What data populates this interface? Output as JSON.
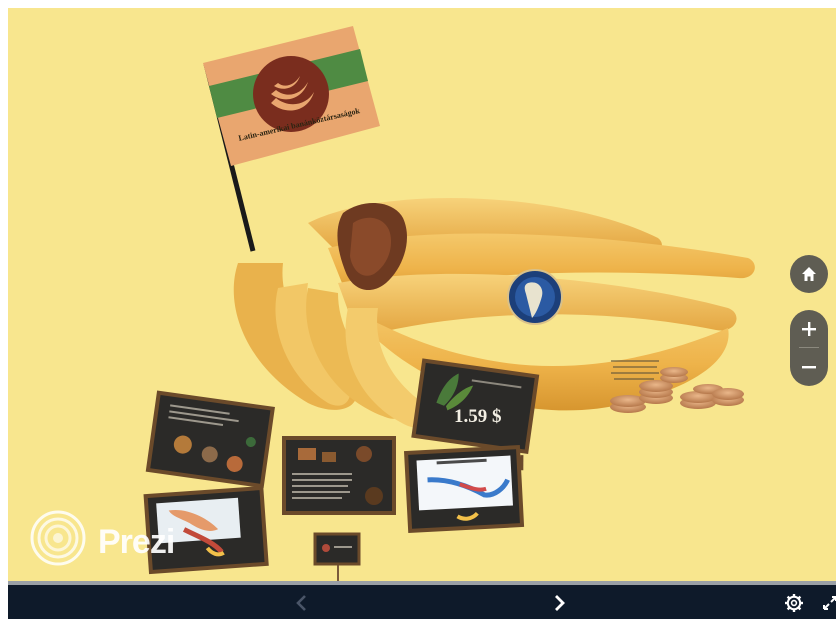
{
  "app": {
    "name": "Prezi"
  },
  "flag": {
    "caption": "Latin-amerikai banánköztársaságok"
  },
  "price_card": {
    "value": "1.59 $"
  },
  "controls": {
    "home": "home-icon",
    "zoom_in": "plus-icon",
    "zoom_out": "minus-icon"
  },
  "bottom_bar": {
    "prev": "chevron-left-icon",
    "next": "chevron-right-icon",
    "settings": "gear-icon",
    "fullscreen": "fullscreen-icon"
  },
  "colors": {
    "background": "#f8e68e",
    "bar": "#0e1a2a",
    "control": "#5f5d53",
    "flag_orange": "#e9a66f",
    "flag_green": "#4f8b43",
    "flag_emblem": "#7a2d1e",
    "board": "#2b2a28"
  }
}
